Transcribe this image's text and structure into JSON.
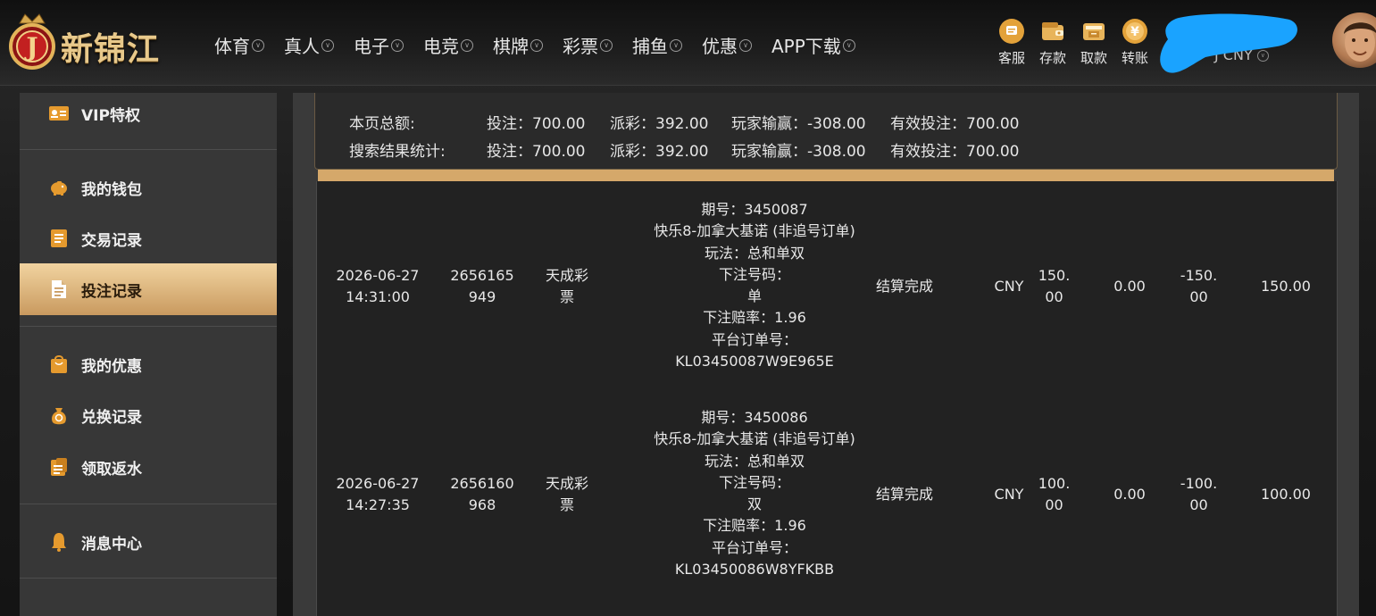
{
  "header": {
    "brand_name": "新锦江",
    "logo_letter": "J",
    "nav": [
      "体育",
      "真人",
      "电子",
      "电竞",
      "棋牌",
      "彩票",
      "捕鱼",
      "优惠",
      "APP下载"
    ],
    "tools": [
      {
        "label": "客服",
        "icon": "chat-icon"
      },
      {
        "label": "存款",
        "icon": "wallet-icon"
      },
      {
        "label": "取款",
        "icon": "atm-icon"
      },
      {
        "label": "转账",
        "icon": "yuan-coin-icon"
      }
    ],
    "balance_text": "J CNY",
    "colors": {
      "gold": "#e8c98b",
      "accent": "#d5a86a",
      "redaction": "#1aa3ff"
    }
  },
  "sidebar": {
    "items": [
      {
        "label": "VIP特权",
        "icon": "vip-card-icon",
        "active": false
      },
      {
        "label": "我的钱包",
        "icon": "piggy-bank-icon",
        "active": false
      },
      {
        "label": "交易记录",
        "icon": "ledger-icon",
        "active": false
      },
      {
        "label": "投注记录",
        "icon": "bet-record-icon",
        "active": true
      },
      {
        "label": "我的优惠",
        "icon": "gift-bag-icon",
        "active": false
      },
      {
        "label": "兑换记录",
        "icon": "money-bag-icon",
        "active": false
      },
      {
        "label": "领取返水",
        "icon": "rebate-icon",
        "active": false
      },
      {
        "label": "消息中心",
        "icon": "bell-icon",
        "active": false
      }
    ]
  },
  "summary": {
    "rows": [
      {
        "label": "本页总额:",
        "bet": "投注：700.00",
        "payout": "派彩：392.00",
        "win_loss": "玩家输赢：-308.00",
        "valid": "有效投注：700.00"
      },
      {
        "label": "搜索结果统计:",
        "bet": "投注：700.00",
        "payout": "派彩：392.00",
        "win_loss": "玩家输赢：-308.00",
        "valid": "有效投注：700.00"
      }
    ]
  },
  "records": [
    {
      "date": "2026-06-27",
      "time": "14:31:00",
      "bet_id": "2656165949",
      "platform": "天成彩票",
      "details": [
        "期号：3450087",
        "快乐8-加拿大基诺 (非追号订单)",
        "玩法：总和单双",
        "下注号码：",
        "单",
        "下注赔率：1.96",
        "平台订单号：",
        "KL03450087W9E965E"
      ],
      "status": "结算完成",
      "currency": "CNY",
      "bet_amount": "150.00",
      "payout": "0.00",
      "win_loss": "-150.00",
      "valid_bet": "150.00"
    },
    {
      "date": "2026-06-27",
      "time": "14:27:35",
      "bet_id": "2656160968",
      "platform": "天成彩票",
      "details": [
        "期号：3450086",
        "快乐8-加拿大基诺 (非追号订单)",
        "玩法：总和单双",
        "下注号码：",
        "双",
        "下注赔率：1.96",
        "平台订单号：",
        "KL03450086W8YFKBB"
      ],
      "status": "结算完成",
      "currency": "CNY",
      "bet_amount": "100.00",
      "payout": "0.00",
      "win_loss": "-100.00",
      "valid_bet": "100.00"
    }
  ]
}
